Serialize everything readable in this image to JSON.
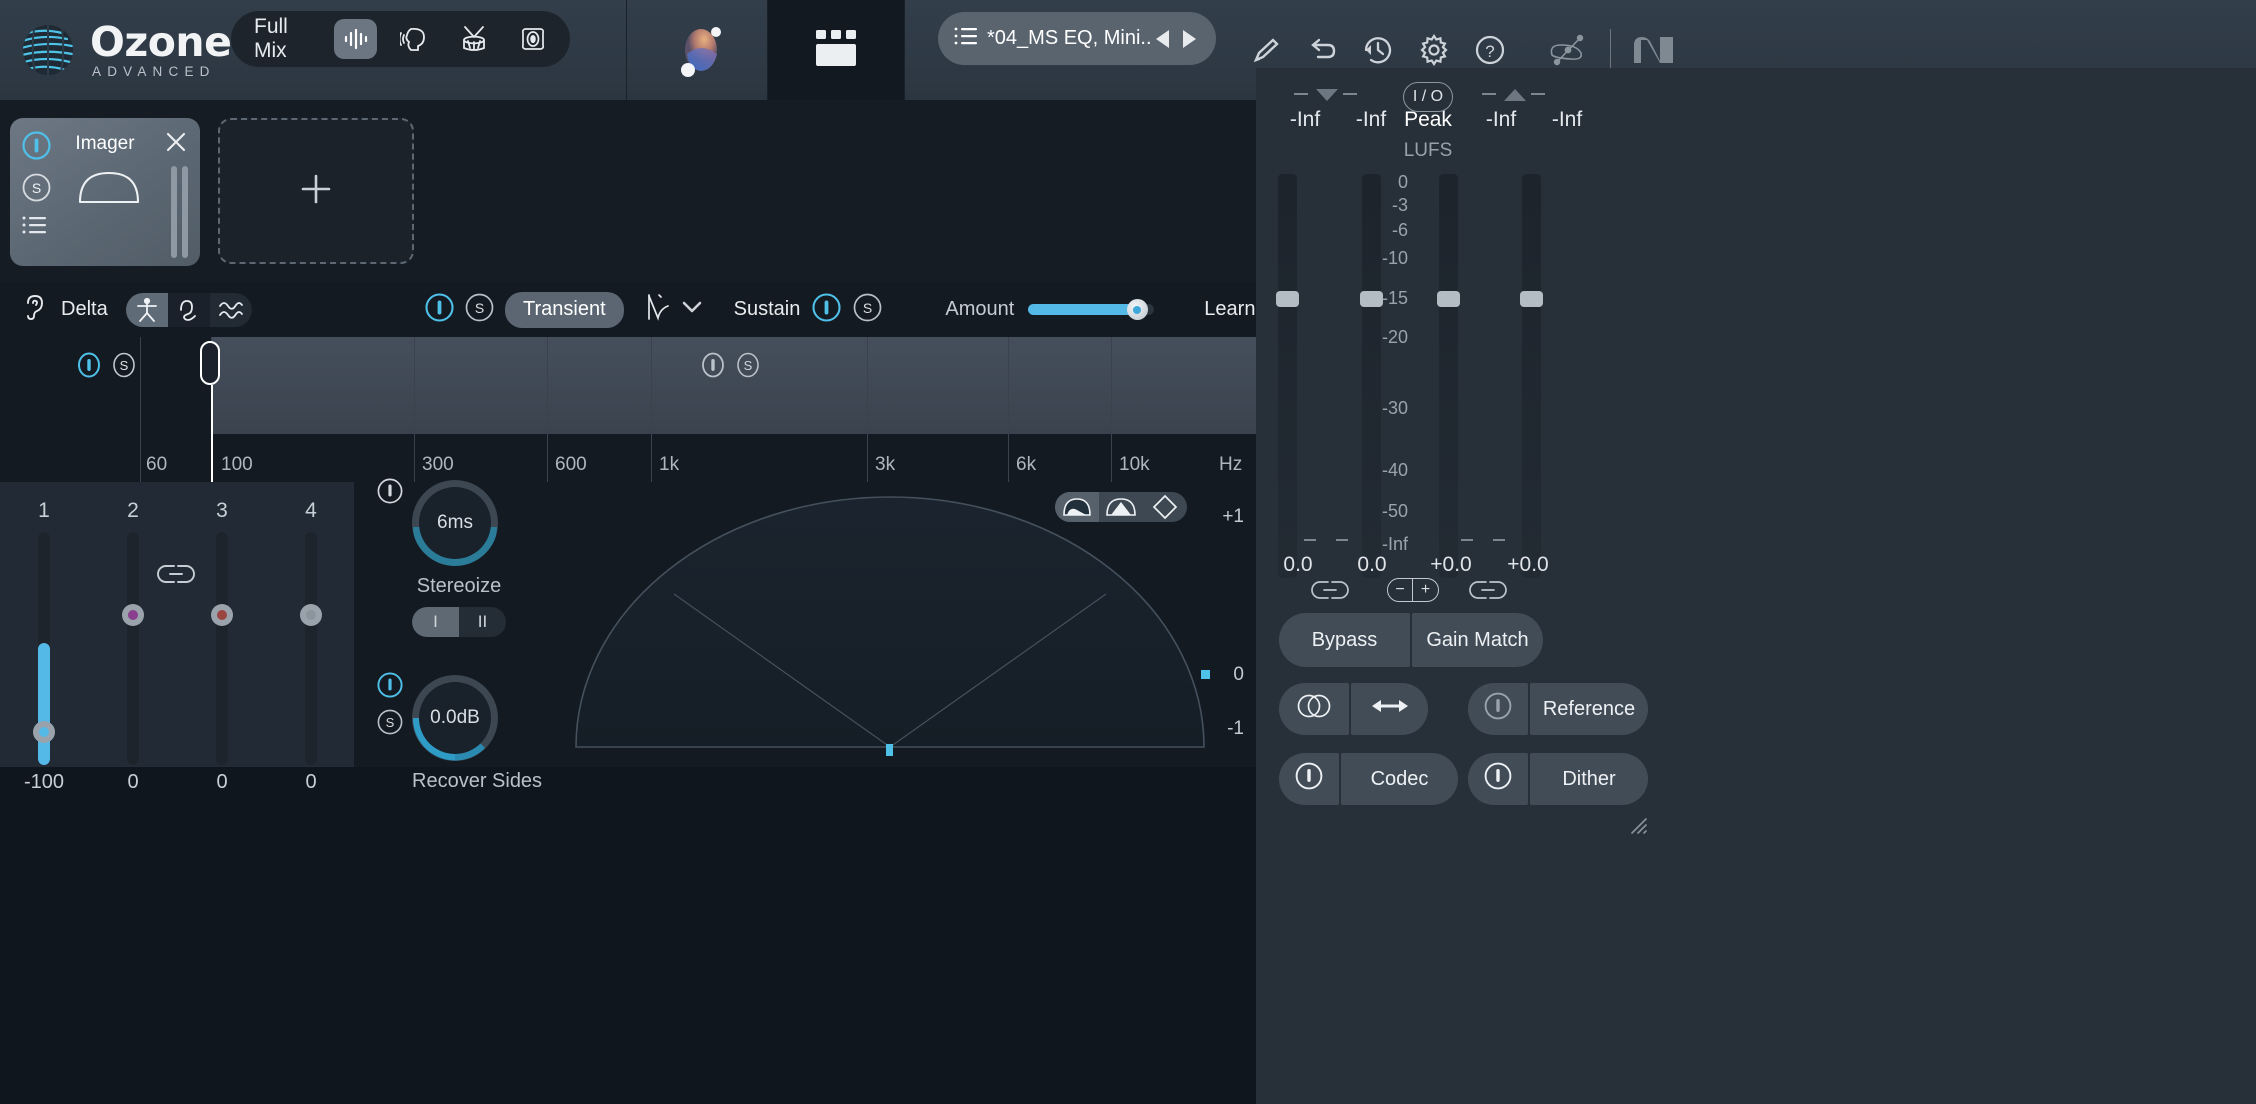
{
  "app": {
    "brand": "Ozone",
    "brand_sub": "ADVANCED",
    "accent_color": "#55b9e8",
    "panel_color": "#273039"
  },
  "topbar": {
    "mix_label": "Full Mix",
    "mix_modes": [
      {
        "name": "full-mix-icon",
        "active": true
      },
      {
        "name": "vocal-icon",
        "active": false
      },
      {
        "name": "drums-icon",
        "active": false
      },
      {
        "name": "bass-icon",
        "active": false
      }
    ],
    "orb_icon": "ozone-assistant-orb-icon",
    "grid_icon": "module-grid-icon",
    "preset": {
      "list_icon": "preset-list-icon",
      "name": "*04_MS EQ, Mini...",
      "prev_icon": "prev-preset-icon",
      "next_icon": "next-preset-icon"
    },
    "icons": [
      {
        "name": "pencil-icon",
        "label": "Edit"
      },
      {
        "name": "undo-icon",
        "label": "Undo"
      },
      {
        "name": "history-icon",
        "label": "History"
      },
      {
        "name": "gear-icon",
        "label": "Options"
      },
      {
        "name": "help-icon",
        "label": "Help"
      },
      {
        "name": "ni-squiggle-icon",
        "label": "Native Access"
      },
      {
        "name": "ni-logo-icon",
        "label": "NI"
      }
    ]
  },
  "rack": {
    "modules": [
      {
        "title": "Imager",
        "power_icon": "power-icon",
        "power_on": true,
        "solo_label": "S",
        "list_icon": "module-options-icon",
        "close_icon": "close-icon",
        "graphic": "imager-curve-icon"
      }
    ],
    "add_label": "+",
    "add_icon": "add-module-icon"
  },
  "deltabar": {
    "ear_icon": "ear-icon",
    "delta_label": "Delta",
    "view_modes": [
      {
        "name": "stereo-figure-icon",
        "active": true
      },
      {
        "name": "waveform-loop-icon",
        "active": false
      },
      {
        "name": "squiggle-icon",
        "active": false
      }
    ],
    "transient": {
      "power_icon": "power-icon",
      "power_on": true,
      "solo_label": "S",
      "label": "Transient"
    },
    "curve_icon": "transient-curve-icon",
    "chevron_icon": "chevron-down-icon",
    "sustain": {
      "label": "Sustain",
      "power_icon": "power-icon",
      "power_on": true,
      "solo_label": "S"
    },
    "amount": {
      "label": "Amount",
      "value": 92,
      "min": 0,
      "max": 100
    },
    "learn_label": "Learn",
    "reset_icon": "reset-circle-icon"
  },
  "bands": {
    "freq_labels": [
      "60",
      "100",
      "300",
      "600",
      "1k",
      "3k",
      "6k",
      "10k",
      "Hz"
    ],
    "crossover_handle_freq": "100",
    "band_controls": [
      {
        "power_icon": "power-icon",
        "power_on": true,
        "solo_label": "S",
        "band": 1
      },
      {
        "power_icon": "power-icon",
        "power_on": false,
        "solo_label": "S",
        "band": 3
      }
    ]
  },
  "band_sliders": {
    "numbers": [
      "1",
      "2",
      "3",
      "4"
    ],
    "values": [
      "-100",
      "0",
      "0",
      "0"
    ],
    "link_icon": "link-icon",
    "dot_colors": [
      "#55b9e8",
      "#8a3f8f",
      "#9a4540",
      "#8c949c"
    ]
  },
  "knobs": [
    {
      "power_icon": "power-icon",
      "power_on": true,
      "value": "6ms",
      "label": "Stereoize",
      "fill_pct": 38,
      "toggle": {
        "options": [
          "I",
          "II"
        ],
        "selected": "I"
      }
    },
    {
      "power_icon": "power-icon",
      "power_on": true,
      "solo_label": "S",
      "value": "0.0dB",
      "label": "Recover Sides",
      "fill_pct": 52
    }
  ],
  "scope": {
    "modes": [
      {
        "name": "polar-sample-icon",
        "active": true
      },
      {
        "name": "polar-level-icon",
        "active": false
      },
      {
        "name": "lissajous-icon",
        "active": false
      }
    ],
    "top_label": "+1",
    "mid_label": "0",
    "bottom_label": "-1"
  },
  "meters": {
    "lufs": {
      "values": [
        "-Inf",
        "-Inf",
        "-Inf",
        "-Inf"
      ],
      "peak_label": "Peak",
      "unit_label": "LUFS",
      "io_label": "I / O",
      "down_icon": "triangle-down-icon",
      "up_icon": "triangle-up-icon"
    },
    "scale": [
      "0",
      "-3",
      "-6",
      "-10",
      "-15",
      "-20",
      "-30",
      "-40",
      "-50",
      "-Inf"
    ],
    "gains": [
      "0.0",
      "0.0",
      "+0.0",
      "+0.0"
    ],
    "link_icon": "link-icon",
    "minus_label": "−",
    "plus_label": "+",
    "buttons": {
      "bypass": "Bypass",
      "gain_match": "Gain Match",
      "stereo_icon": "overlap-circles-icon",
      "width_icon": "left-right-arrow-icon",
      "reference": "Reference",
      "codec": "Codec",
      "dither": "Dither",
      "power_icon": "power-icon"
    },
    "resize_icon": "resize-grip-icon"
  }
}
